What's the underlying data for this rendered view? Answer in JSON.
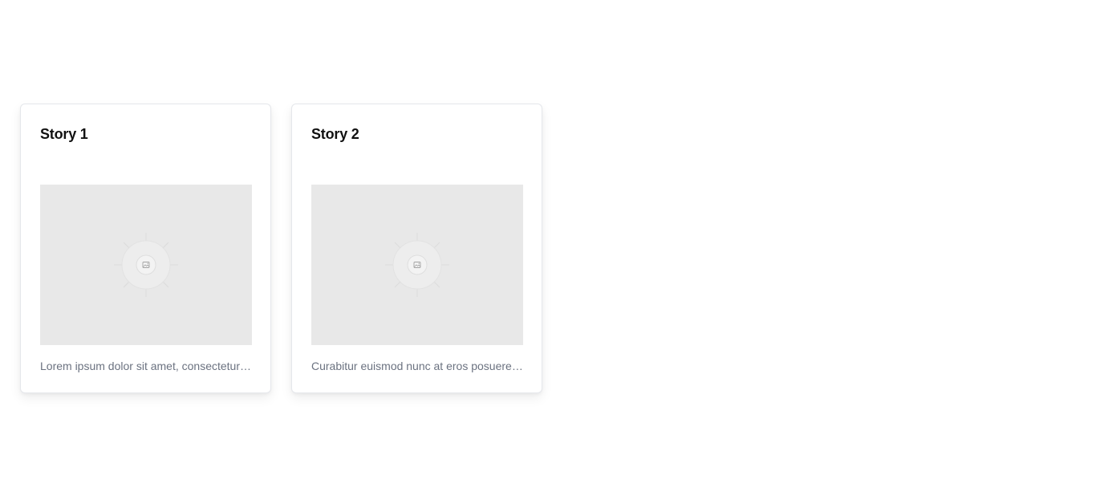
{
  "stories": [
    {
      "title": "Story 1",
      "image_icon": "image-placeholder-icon",
      "description": "Lorem ipsum dolor sit amet, consectetur adipiscing elit."
    },
    {
      "title": "Story 2",
      "image_icon": "image-placeholder-icon",
      "description": "Curabitur euismod nunc at eros posuere, vitae tempus lorem."
    }
  ],
  "colors": {
    "image_background": "#e8e8e8",
    "title": "#111111",
    "description": "#6b7280",
    "card_border": "#e5e7eb"
  }
}
